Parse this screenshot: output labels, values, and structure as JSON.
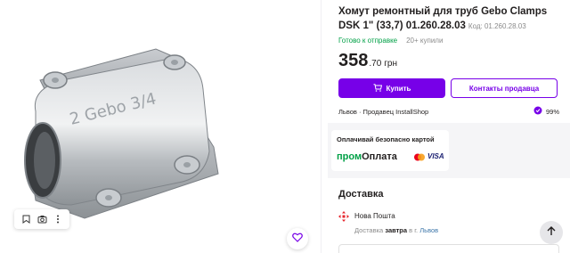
{
  "product": {
    "title": "Хомут ремонтный для труб Gebo Clamps DSK 1\" (33,7) 01.260.28.03",
    "code_label": "Код: 01.260.28.03",
    "status": "Готово к отправке",
    "bought": "20+ купили",
    "price_main": "358",
    "price_cents": ".70",
    "currency": "грн",
    "image_text": "2 Gebo 3/4"
  },
  "actions": {
    "buy_label": "Купить",
    "contact_label": "Контакты продавца"
  },
  "seller": {
    "text": "Львов · Продавец InstallShop",
    "rating": "99%"
  },
  "payment": {
    "title": "Оплачивай безопасно картой",
    "brand_prefix": "пром",
    "brand_suffix": "Оплата",
    "visa": "VISA"
  },
  "delivery": {
    "heading": "Доставка",
    "carrier": "Нова Пошта",
    "date_prefix": "Доставка",
    "date_value": "завтра",
    "date_mid": "в г.",
    "city": "Львов"
  },
  "colors": {
    "accent": "#7700e8",
    "green": "#00a046",
    "link": "#3e77aa",
    "nova_poshta": "#e6252c"
  },
  "icons": [
    "bookmark-icon",
    "camera-icon",
    "more-icon",
    "heart-icon",
    "cart-icon",
    "seller-rating-icon",
    "nova-poshta-icon",
    "arrow-up-icon",
    "mastercard-icon"
  ]
}
